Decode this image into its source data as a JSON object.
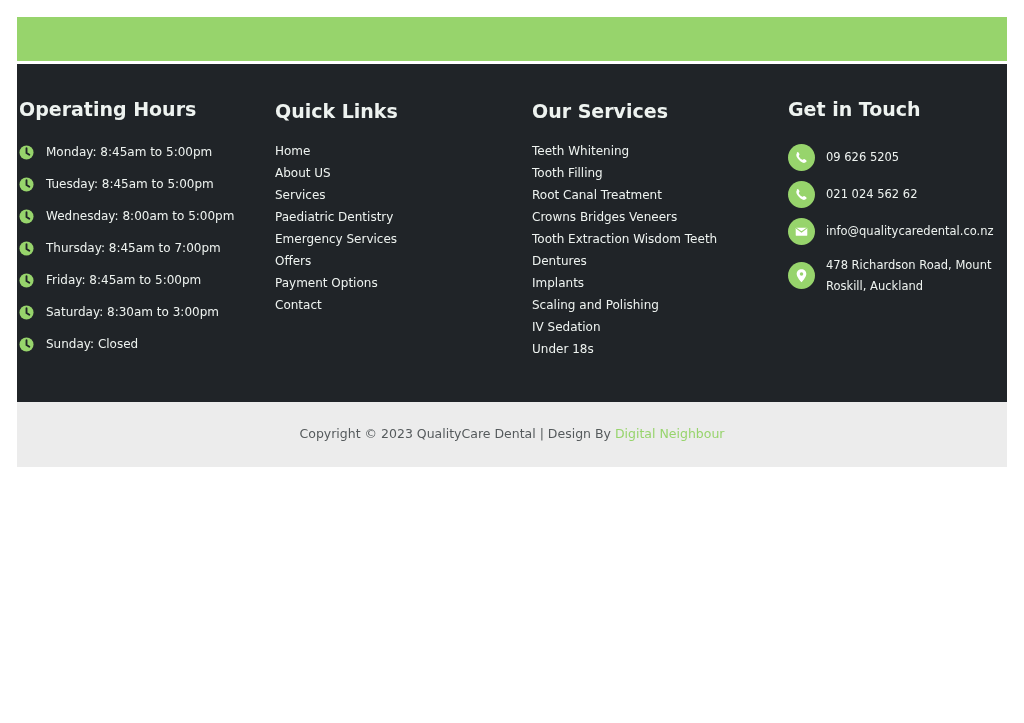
{
  "operating_hours": {
    "title": "Operating Hours",
    "items": [
      "Monday: 8:45am to 5:00pm",
      "Tuesday: 8:45am to 5:00pm",
      "Wednesday: 8:00am to 5:00pm",
      "Thursday: 8:45am to 7:00pm",
      "Friday: 8:45am to 5:00pm",
      "Saturday: 8:30am to 3:00pm",
      "Sunday: Closed"
    ]
  },
  "quick_links": {
    "title": "Quick Links",
    "items": [
      "Home",
      "About US",
      "Services",
      "Paediatric Dentistry",
      "Emergency Services",
      "Offers",
      "Payment Options",
      "Contact"
    ]
  },
  "our_services": {
    "title": "Our Services",
    "items": [
      "Teeth Whitening",
      "Tooth Filling",
      "Root Canal Treatment",
      "Crowns Bridges Veneers",
      "Tooth Extraction Wisdom Teeth",
      "Dentures",
      "Implants",
      "Scaling and Polishing",
      "IV Sedation",
      "Under 18s"
    ]
  },
  "get_in_touch": {
    "title": "Get in Touch",
    "items": [
      {
        "kind": "phone",
        "text": "09 626 5205"
      },
      {
        "kind": "phone",
        "text": "021 024 562 62"
      },
      {
        "kind": "email",
        "text": "info@qualitycaredental.co.nz"
      },
      {
        "kind": "location",
        "text": "478 Richardson Road, Mount Roskill, Auckland"
      }
    ]
  },
  "copyright": {
    "text": "Copyright © 2023 QualityCare Dental | Design By",
    "link": "Digital Neighbour"
  }
}
